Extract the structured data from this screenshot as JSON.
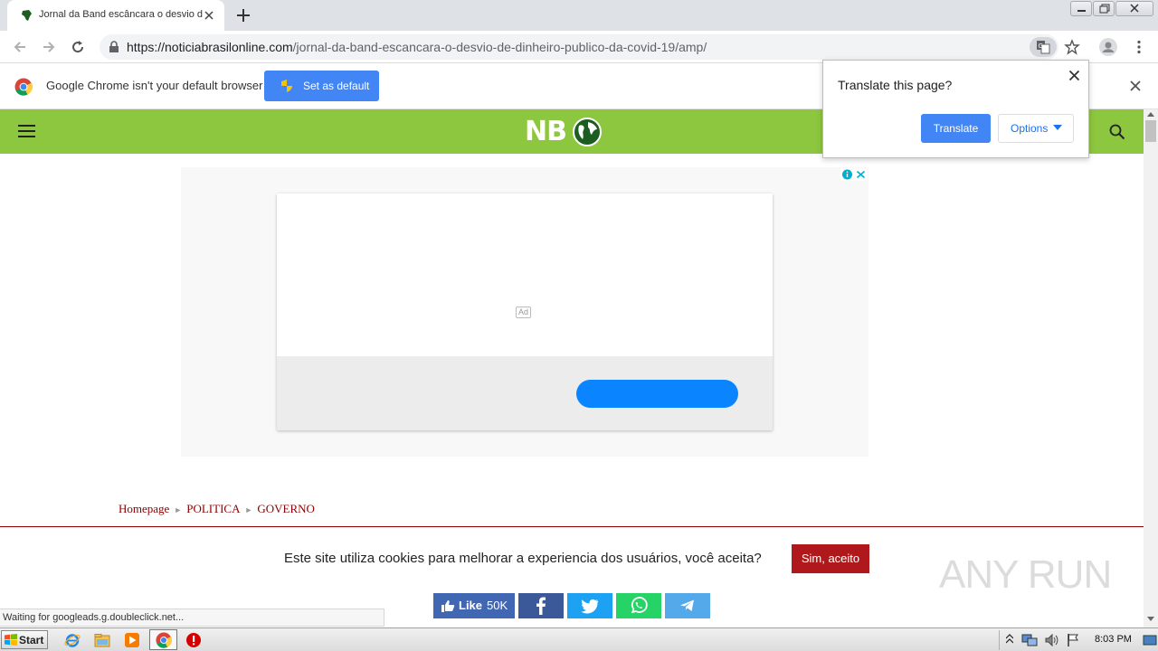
{
  "browser": {
    "tab_title": "Jornal da Band escâncara o desvio d",
    "url_domain": "https://noticiabrasilonline.com",
    "url_path": "/jornal-da-band-escancara-o-desvio-de-dinheiro-publico-da-covid-19/amp/"
  },
  "infobar": {
    "message": "Google Chrome isn't your default browser",
    "set_default_label": "Set as default"
  },
  "translate_popup": {
    "question": "Translate this page?",
    "translate_label": "Translate",
    "options_label": "Options"
  },
  "site": {
    "logo_text": "NB",
    "ad_label": "Ad",
    "breadcrumb": [
      "Homepage",
      "POLITICA",
      "GOVERNO"
    ],
    "cookie_message": "Este site utiliza cookies para melhorar a experiencia dos usuários, você aceita?",
    "cookie_accept": "Sim, aceito",
    "like_label": "Like",
    "like_count": "50K"
  },
  "status_bar": "Waiting for googleads.g.doubleclick.net...",
  "watermark": "ANY RUN",
  "taskbar": {
    "start_label": "Start",
    "clock": "8:03 PM"
  },
  "colors": {
    "site_green": "#8dc63f",
    "chrome_blue": "#4285f4",
    "cookie_red": "#b0191b",
    "breadcrumb_red": "#8b0000"
  }
}
